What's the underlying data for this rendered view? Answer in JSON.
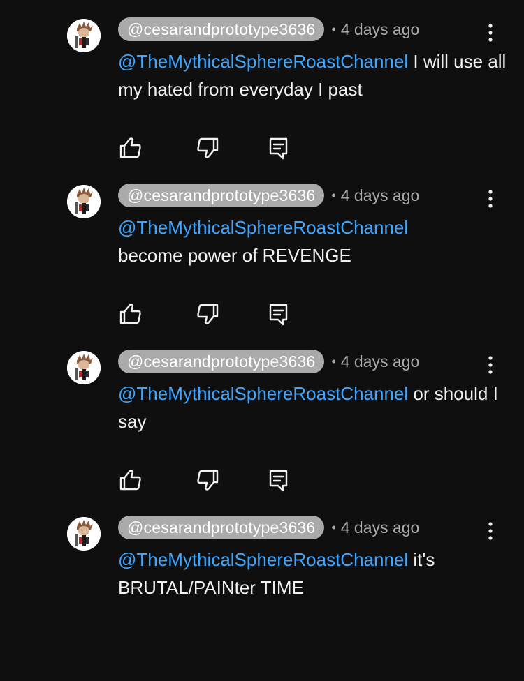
{
  "comments": [
    {
      "handle": "@cesarandprototype3636",
      "separator": "•",
      "time": "4 days ago",
      "mention": "@TheMythicalSphereRoastChannel",
      "text": " I will use all my hated from everyday I past"
    },
    {
      "handle": "@cesarandprototype3636",
      "separator": "•",
      "time": "4 days ago",
      "mention": "@TheMythicalSphereRoastChannel",
      "text": " become power of REVENGE"
    },
    {
      "handle": "@cesarandprototype3636",
      "separator": "•",
      "time": "4 days ago",
      "mention": "@TheMythicalSphereRoastChannel",
      "text": " or should I say"
    },
    {
      "handle": "@cesarandprototype3636",
      "separator": "•",
      "time": "4 days ago",
      "mention": "@TheMythicalSphereRoastChannel",
      "text": " it's BRUTAL/PAINter TIME"
    }
  ],
  "icons": {
    "avatar": "avatar-icon",
    "like": "thumbs-up-icon",
    "dislike": "thumbs-down-icon",
    "reply": "reply-icon",
    "more": "more-vertical-icon"
  },
  "colors": {
    "background": "#0f0f0f",
    "text": "#f1f1f1",
    "mention": "#3ea6ff",
    "chip": "#aaaaaa",
    "secondary": "#aaaaaa"
  }
}
